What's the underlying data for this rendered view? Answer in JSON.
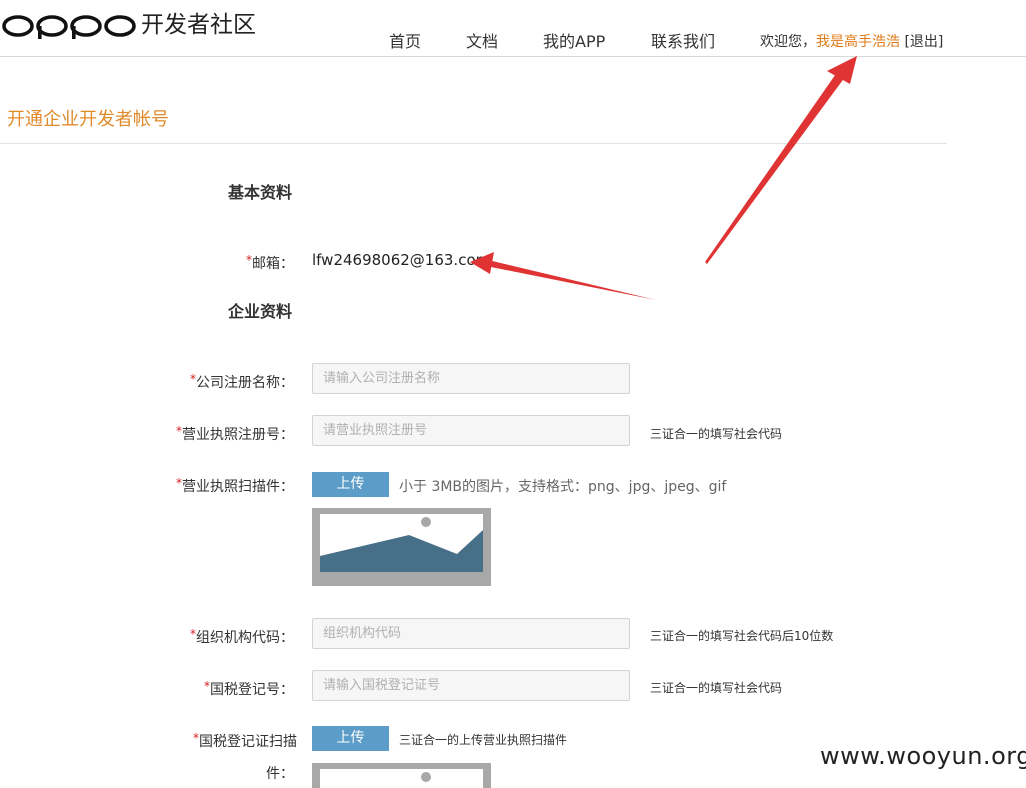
{
  "header": {
    "logo_text": "OPPO",
    "site_name": "开发者社区",
    "nav": [
      "首页",
      "文档",
      "我的APP",
      "联系我们"
    ],
    "welcome": "欢迎您，",
    "username": "我是高手浩浩",
    "logout_open": " [",
    "logout": "退出",
    "logout_close": "]"
  },
  "page": {
    "title": "开通企业开发者帐号"
  },
  "basic": {
    "heading": "基本资料",
    "email_label": "邮箱：",
    "email_value": "lfw24698062@163.com"
  },
  "company": {
    "heading": "企业资料",
    "required_mark": "*",
    "name_label": "公司注册名称：",
    "name_placeholder": "请输入公司注册名称",
    "license_label": "营业执照注册号：",
    "license_placeholder": "请营业执照注册号",
    "license_hint": "三证合一的填写社会代码",
    "scan_label": "营业执照扫描件：",
    "upload_label": "上传",
    "scan_hint": "小于 3MB的图片，支持格式：png、jpg、jpeg、gif",
    "org_label": "组织机构代码：",
    "org_placeholder": "组织机构代码",
    "org_hint": "三证合一的填写社会代码后10位数",
    "tax_label": "国税登记号：",
    "tax_placeholder": "请输入国税登记证号",
    "tax_hint": "三证合一的填写社会代码",
    "tax_scan_label_1": "国税登记证扫描",
    "tax_scan_label_2": "件：",
    "tax_upload_label": "上传",
    "tax_scan_hint": "三证合一的上传营业执照扫描件"
  },
  "watermark": "www.wooyun.org",
  "colors": {
    "accent_orange": "#e08a2c",
    "username_orange": "#e07a18",
    "upload_blue": "#5b9cc9",
    "arrow_red": "#e03434",
    "image_dark": "#476f87"
  }
}
